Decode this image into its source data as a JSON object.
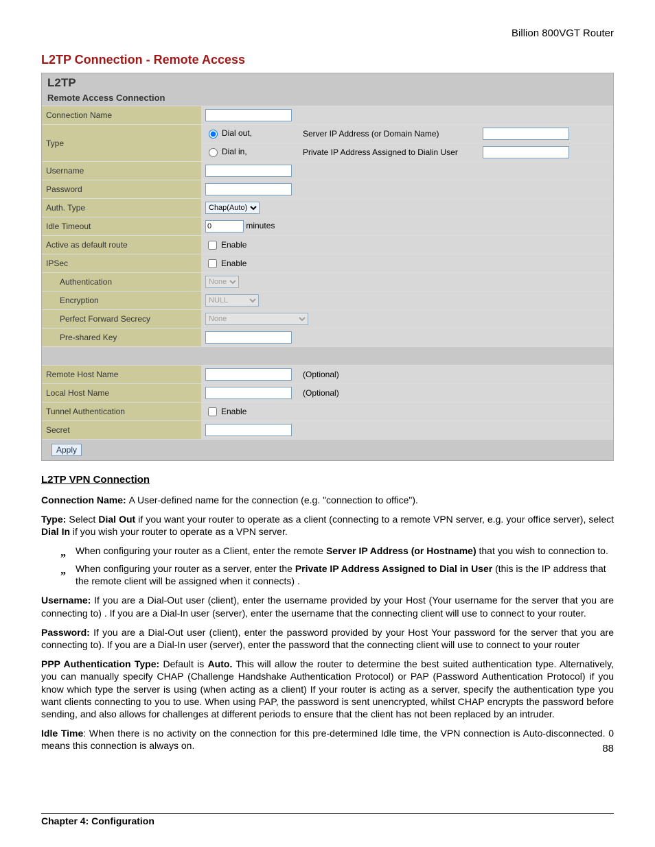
{
  "header": {
    "product": "Billion 800VGT Router"
  },
  "title": "L2TP Connection - Remote Access",
  "panel": {
    "title": "L2TP",
    "subtitle": "Remote Access Connection"
  },
  "rows": {
    "connection_name": "Connection Name",
    "type": "Type",
    "dial_out": "Dial out,",
    "dial_out_desc": "Server IP Address (or Domain Name)",
    "dial_in": "Dial in,",
    "dial_in_desc": "Private IP Address Assigned to Dialin User",
    "username": "Username",
    "password": "Password",
    "auth_type": "Auth. Type",
    "auth_type_val": "Chap(Auto)",
    "idle_timeout": "Idle Timeout",
    "idle_val": "0",
    "minutes": "minutes",
    "default_route": "Active as default route",
    "enable": "Enable",
    "ipsec": "IPSec",
    "authentication": "Authentication",
    "auth_val": "None",
    "encryption": "Encryption",
    "enc_val": "NULL",
    "pfs": "Perfect Forward Secrecy",
    "pfs_val": "None",
    "psk": "Pre-shared Key",
    "remote_host": "Remote Host Name",
    "local_host": "Local Host Name",
    "optional": "(Optional)",
    "tunnel_auth": "Tunnel Authentication",
    "secret": "Secret",
    "apply": "Apply"
  },
  "doc": {
    "section_head": "L2TP VPN Connection",
    "p_conn_name": "A User-defined name for the connection (e.g. \"connection to office\").",
    "p_type_1": "Select ",
    "p_type_2": " if you want your router to operate as a client (connecting to a remote VPN server, e.g. your office server), select ",
    "p_type_3": " if you wish your router to operate as a VPN server.",
    "b1_a": "When configuring your router as a Client, enter the remote ",
    "b1_b": "Server IP Address (or Hostname)",
    "b1_c": " that you wish to connection to.",
    "b2_a": "When configuring your router as a server, enter the ",
    "b2_b": "Private IP Address Assigned to Dial in User",
    "b2_c": " (this is the IP address that the remote client will be assigned when it connects) .",
    "p_user": "If you are a Dial-Out user (client), enter the username provided by your Host (Your username for the server that you are connecting to) . If you are a Dial-In user (server), enter the username that the connecting client will use to connect to your router.",
    "p_pass": "If you are a Dial-Out user (client), enter the password provided by your Host Your password for the server that you are connecting to).      If you are a Dial-In user (server), enter the password that the connecting client will use to connect to your router",
    "p_ppp_a": "Default is ",
    "p_ppp_b": "Auto.",
    "p_ppp_c": " This will allow the router to determine the best suited authentication type. Alternatively, you can manually specify CHAP (Challenge Handshake Authentication Protocol) or PAP (Password Authentication Protocol) if you know which type the server is using (when acting as a client) If your router is acting as a server, specify the authentication type you want clients connecting to you to use. When using PAP, the password is sent unencrypted, whilst CHAP encrypts the password before sending, and also allows for challenges at different periods to ensure that the client has not been replaced by an intruder.",
    "p_idle": ": When there is no activity on the connection for this pre-determined Idle time, the VPN connection is Auto-disconnected. 0 means this connection is always on.",
    "labels": {
      "conn_name": "Connection Name: ",
      "type": "Type: ",
      "dial_out": "Dial Out",
      "dial_in": "Dial In",
      "username": "Username: ",
      "password": "Password: ",
      "ppp": "PPP Authentication Type: ",
      "idle": "Idle Time"
    }
  },
  "footer": {
    "chapter": "Chapter 4: Configuration",
    "page": "88"
  }
}
